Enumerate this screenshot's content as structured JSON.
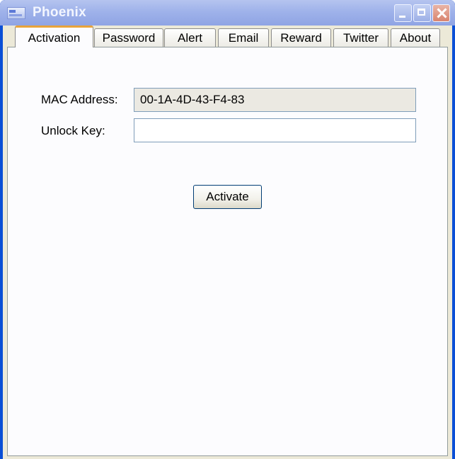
{
  "window": {
    "title": "Phoenix"
  },
  "tabs": [
    {
      "label": "Activation",
      "active": true
    },
    {
      "label": "Password",
      "active": false
    },
    {
      "label": "Alert",
      "active": false
    },
    {
      "label": "Email",
      "active": false
    },
    {
      "label": "Reward",
      "active": false
    },
    {
      "label": "Twitter",
      "active": false
    },
    {
      "label": "About",
      "active": false
    }
  ],
  "activation": {
    "mac_label": "MAC Address:",
    "mac_value": "00-1A-4D-43-F4-83",
    "unlock_label": "Unlock Key:",
    "unlock_value": "",
    "activate_label": "Activate"
  },
  "colors": {
    "active_tab_accent": "#e8a33a",
    "title_text": "#f3f6ff",
    "close_button": "#d9846f"
  },
  "icons": [
    "app-icon",
    "minimize-icon",
    "maximize-icon",
    "close-icon"
  ]
}
